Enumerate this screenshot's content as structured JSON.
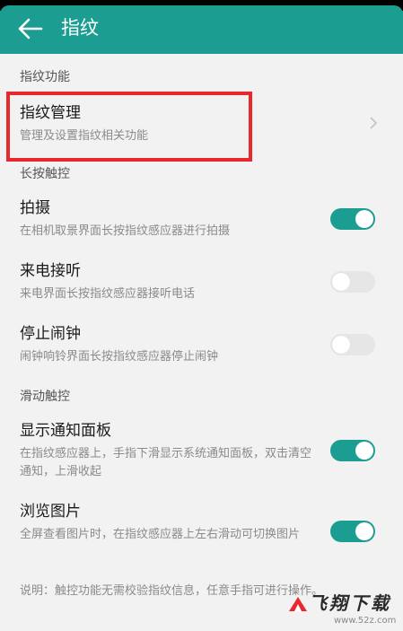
{
  "header": {
    "title": "指纹",
    "bg_color": "#1b9e91"
  },
  "sections": [
    {
      "header": "指纹功能",
      "items": [
        {
          "title": "指纹管理",
          "subtitle": "管理及设置指纹相关功能",
          "control": "chevron-right-icon"
        }
      ]
    },
    {
      "header": "长按触控",
      "items": [
        {
          "title": "拍摄",
          "subtitle": "在相机取景界面长按指纹感应器进行拍摄",
          "control": "toggle",
          "on": true
        },
        {
          "title": "来电接听",
          "subtitle": "来电界面长按指纹感应器接听电话",
          "control": "toggle",
          "on": false
        },
        {
          "title": "停止闹钟",
          "subtitle": "闹钟响铃界面长按指纹感应器停止闹钟",
          "control": "toggle",
          "on": false
        }
      ]
    },
    {
      "header": "滑动触控",
      "items": [
        {
          "title": "显示通知面板",
          "subtitle": "在指纹感应器上，手指下滑显示系统通知面板，双击清空通知，上滑收起",
          "control": "toggle",
          "on": true
        },
        {
          "title": "浏览图片",
          "subtitle": "全屏查看图片时，在指纹感应器上左右滑动可切换图片",
          "control": "toggle",
          "on": true
        }
      ]
    }
  ],
  "note": "说明：触控功能无需校验指纹信息，任意手指可进行操作。",
  "watermark": {
    "text": "飞翔下载",
    "url": "www.52z.com"
  },
  "colors": {
    "accent": "#1b9e91",
    "highlight": "#e8282d"
  }
}
